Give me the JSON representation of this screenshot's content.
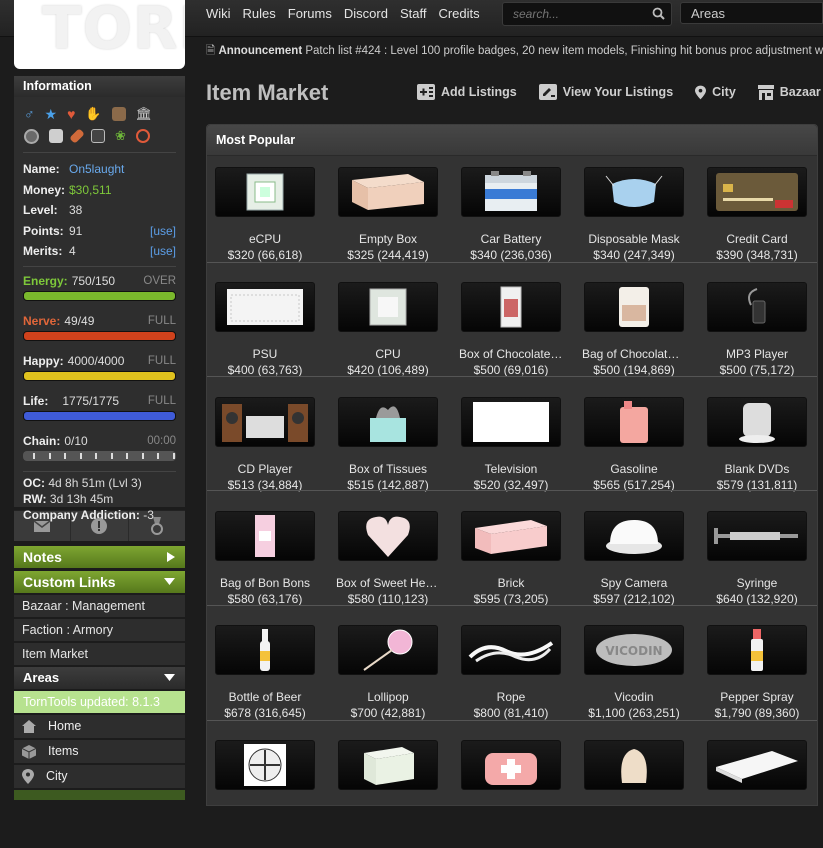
{
  "logo": "TORN",
  "nav": [
    "Wiki",
    "Rules",
    "Forums",
    "Discord",
    "Staff",
    "Credits"
  ],
  "search": {
    "placeholder": "search..."
  },
  "areas_select": "Areas",
  "announcement": {
    "label": "Announcement",
    "text": "Patch list #424 : Level 100 profile badges, 20 new item models, Finishing hit bonus proc adjustment w"
  },
  "sidebar": {
    "info_title": "Information",
    "name_label": "Name:",
    "name": "On5laught",
    "money_label": "Money:",
    "money": "$30,511",
    "level_label": "Level:",
    "level": "38",
    "points_label": "Points:",
    "points": "91",
    "points_use": "[use]",
    "merits_label": "Merits:",
    "merits": "4",
    "merits_use": "[use]",
    "energy": {
      "label": "Energy:",
      "value": "750/150",
      "status": "OVER",
      "fill": 1.0,
      "color": "#7ab82c"
    },
    "nerve": {
      "label": "Nerve:",
      "value": "49/49",
      "status": "FULL",
      "fill": 1.0,
      "color": "#d0421c"
    },
    "happy": {
      "label": "Happy:",
      "value": "4000/4000",
      "status": "FULL",
      "fill": 1.0,
      "color": "#e0c21e"
    },
    "life": {
      "label": "Life:",
      "value": "1775/1775",
      "status": "FULL",
      "fill": 1.0,
      "color": "#3f5bd8"
    },
    "chain": {
      "label": "Chain:",
      "value": "0/10",
      "status": "00:00"
    },
    "oc_label": "OC:",
    "oc": "4d 8h 51m (Lvl 3)",
    "rw_label": "RW:",
    "rw": "3d 13h 45m",
    "addiction_label": "Company Addiction:",
    "addiction": "-3",
    "notes": "Notes",
    "custom_links": "Custom Links",
    "links": [
      "Bazaar : Management",
      "Faction : Armory",
      "Item Market"
    ],
    "areas": "Areas",
    "updated": "TornTools updated: 8.1.3",
    "area_items": [
      "Home",
      "Items",
      "City"
    ]
  },
  "page_title": "Item Market",
  "toolbar": [
    "Add Listings",
    "View Your Listings",
    "City",
    "Bazaar"
  ],
  "market_title": "Most Popular",
  "items": [
    {
      "name": "eCPU",
      "price": "$320 (66,618)",
      "art": "ecpu"
    },
    {
      "name": "Empty Box",
      "price": "$325 (244,419)",
      "art": "box"
    },
    {
      "name": "Car Battery",
      "price": "$340 (236,036)",
      "art": "battery"
    },
    {
      "name": "Disposable Mask",
      "price": "$340 (247,349)",
      "art": "mask"
    },
    {
      "name": "Credit Card",
      "price": "$390 (348,731)",
      "art": "card"
    },
    {
      "name": "PSU",
      "price": "$400 (63,763)",
      "art": "psu"
    },
    {
      "name": "CPU",
      "price": "$420 (106,489)",
      "art": "cpu"
    },
    {
      "name": "Box of Chocolate Bars",
      "price": "$500 (69,016)",
      "art": "chocbox"
    },
    {
      "name": "Bag of Chocolate Kisses",
      "price": "$500 (194,869)",
      "art": "chocbag"
    },
    {
      "name": "MP3 Player",
      "price": "$500 (75,172)",
      "art": "mp3"
    },
    {
      "name": "CD Player",
      "price": "$513 (34,884)",
      "art": "cd"
    },
    {
      "name": "Box of Tissues",
      "price": "$515 (142,887)",
      "art": "tissue"
    },
    {
      "name": "Television",
      "price": "$520 (32,497)",
      "art": "tv"
    },
    {
      "name": "Gasoline",
      "price": "$565 (517,254)",
      "art": "gas"
    },
    {
      "name": "Blank DVDs",
      "price": "$579 (131,811)",
      "art": "dvd"
    },
    {
      "name": "Bag of Bon Bons",
      "price": "$580 (63,176)",
      "art": "bonbon"
    },
    {
      "name": "Box of Sweet Hearts",
      "price": "$580 (110,123)",
      "art": "heart"
    },
    {
      "name": "Brick",
      "price": "$595 (73,205)",
      "art": "brick"
    },
    {
      "name": "Spy Camera",
      "price": "$597 (212,102)",
      "art": "spycam"
    },
    {
      "name": "Syringe",
      "price": "$640 (132,920)",
      "art": "syringe"
    },
    {
      "name": "Bottle of Beer",
      "price": "$678 (316,645)",
      "art": "beer"
    },
    {
      "name": "Lollipop",
      "price": "$700 (42,881)",
      "art": "lollipop"
    },
    {
      "name": "Rope",
      "price": "$800 (81,410)",
      "art": "rope"
    },
    {
      "name": "Vicodin",
      "price": "$1,100 (263,251)",
      "art": "vicodin",
      "art_text": "VICODIN"
    },
    {
      "name": "Pepper Spray",
      "price": "$1,790 (89,360)",
      "art": "spray"
    },
    {
      "name": "",
      "price": "",
      "art": "fan"
    },
    {
      "name": "",
      "price": "",
      "art": "crate"
    },
    {
      "name": "",
      "price": "",
      "art": "medkit"
    },
    {
      "name": "",
      "price": "",
      "art": "bell"
    },
    {
      "name": "",
      "price": "",
      "art": "paper"
    }
  ]
}
